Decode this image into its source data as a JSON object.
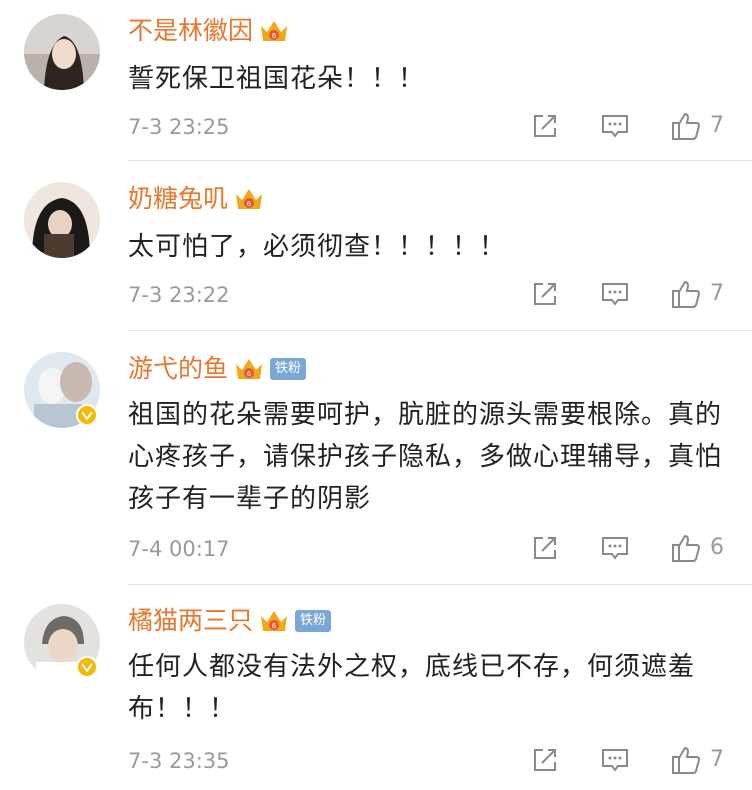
{
  "comments": [
    {
      "username": "不是林徽因",
      "text": "誓死保卫祖国花朵！！！",
      "time": "7-3 23:25",
      "likes": "7",
      "fan_badge": null,
      "verified": false
    },
    {
      "username": "奶糖兔叽",
      "text": "太可怕了，必须彻查！！！！！",
      "time": "7-3 23:22",
      "likes": "7",
      "fan_badge": null,
      "verified": false
    },
    {
      "username": "游弋的鱼",
      "text": "祖国的花朵需要呵护，肮脏的源头需要根除。真的心疼孩子，请保护孩子隐私，多做心理辅导，真怕孩子有一辈子的阴影",
      "time": "7-4 00:17",
      "likes": "6",
      "fan_badge": "铁粉",
      "verified": true
    },
    {
      "username": "橘猫两三只",
      "text": "任何人都没有法外之权，底线已不存，何须遮羞布！！！",
      "time": "7-3 23:35",
      "likes": "7",
      "fan_badge": "铁粉",
      "verified": true
    }
  ],
  "icons": {
    "share": "share-icon",
    "comment": "comment-icon",
    "like": "thumbs-up-icon",
    "crown": "crown-badge-icon",
    "verified": "verified-v-icon"
  },
  "colors": {
    "username": "#e8772e",
    "text": "#222222",
    "meta": "#9a9a9a",
    "crown": "#f0a81a",
    "fan_badge": "#7ba7d6",
    "verified": "#f6b800"
  }
}
